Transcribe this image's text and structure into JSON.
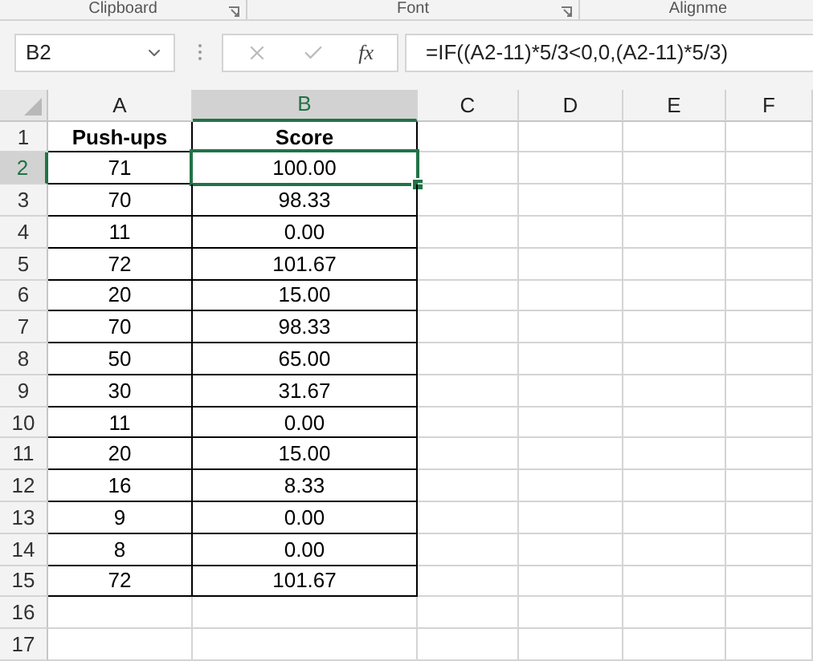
{
  "ribbon_groups": [
    {
      "label": "Clipboard",
      "launcher": true
    },
    {
      "label": "Font",
      "launcher": true
    },
    {
      "label": "Alignme",
      "launcher": false
    }
  ],
  "name_box": {
    "value": "B2"
  },
  "formula_bar": {
    "function_label": "fx",
    "value": "=IF((A2-11)*5/3<0,0,(A2-11)*5/3)"
  },
  "columns": [
    {
      "label": "A",
      "selected": false
    },
    {
      "label": "B",
      "selected": true
    },
    {
      "label": "C",
      "selected": false
    },
    {
      "label": "D",
      "selected": false
    },
    {
      "label": "E",
      "selected": false
    },
    {
      "label": "F",
      "selected": false
    }
  ],
  "rows": [
    {
      "number": "1",
      "selected": false,
      "kind": "header",
      "cells": [
        {
          "text": "Push-ups",
          "selected": false
        },
        {
          "text": "Score",
          "selected": false
        }
      ]
    },
    {
      "number": "2",
      "selected": true,
      "kind": "data",
      "cells": [
        {
          "text": "71",
          "selected": false
        },
        {
          "text": "100.00",
          "selected": true
        }
      ]
    },
    {
      "number": "3",
      "selected": false,
      "kind": "data",
      "cells": [
        {
          "text": "70",
          "selected": false
        },
        {
          "text": "98.33",
          "selected": false
        }
      ]
    },
    {
      "number": "4",
      "selected": false,
      "kind": "data",
      "cells": [
        {
          "text": "11",
          "selected": false
        },
        {
          "text": "0.00",
          "selected": false
        }
      ]
    },
    {
      "number": "5",
      "selected": false,
      "kind": "data",
      "cells": [
        {
          "text": "72",
          "selected": false
        },
        {
          "text": "101.67",
          "selected": false
        }
      ]
    },
    {
      "number": "6",
      "selected": false,
      "kind": "data",
      "cells": [
        {
          "text": "20",
          "selected": false
        },
        {
          "text": "15.00",
          "selected": false
        }
      ]
    },
    {
      "number": "7",
      "selected": false,
      "kind": "data",
      "cells": [
        {
          "text": "70",
          "selected": false
        },
        {
          "text": "98.33",
          "selected": false
        }
      ]
    },
    {
      "number": "8",
      "selected": false,
      "kind": "data",
      "cells": [
        {
          "text": "50",
          "selected": false
        },
        {
          "text": "65.00",
          "selected": false
        }
      ]
    },
    {
      "number": "9",
      "selected": false,
      "kind": "data",
      "cells": [
        {
          "text": "30",
          "selected": false
        },
        {
          "text": "31.67",
          "selected": false
        }
      ]
    },
    {
      "number": "10",
      "selected": false,
      "kind": "data",
      "cells": [
        {
          "text": "11",
          "selected": false
        },
        {
          "text": "0.00",
          "selected": false
        }
      ]
    },
    {
      "number": "11",
      "selected": false,
      "kind": "data",
      "cells": [
        {
          "text": "20",
          "selected": false
        },
        {
          "text": "15.00",
          "selected": false
        }
      ]
    },
    {
      "number": "12",
      "selected": false,
      "kind": "data",
      "cells": [
        {
          "text": "16",
          "selected": false
        },
        {
          "text": "8.33",
          "selected": false
        }
      ]
    },
    {
      "number": "13",
      "selected": false,
      "kind": "data",
      "cells": [
        {
          "text": "9",
          "selected": false
        },
        {
          "text": "0.00",
          "selected": false
        }
      ]
    },
    {
      "number": "14",
      "selected": false,
      "kind": "data",
      "cells": [
        {
          "text": "8",
          "selected": false
        },
        {
          "text": "0.00",
          "selected": false
        }
      ]
    },
    {
      "number": "15",
      "selected": false,
      "kind": "data",
      "cells": [
        {
          "text": "72",
          "selected": false
        },
        {
          "text": "101.67",
          "selected": false
        }
      ]
    },
    {
      "number": "16",
      "selected": false,
      "kind": "empty"
    },
    {
      "number": "17",
      "selected": false,
      "kind": "empty"
    }
  ]
}
